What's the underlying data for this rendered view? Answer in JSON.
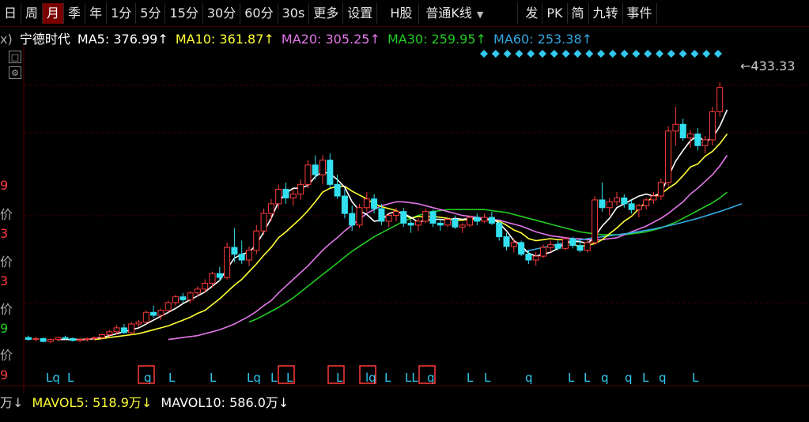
{
  "toolbar": {
    "items": [
      "日",
      "周",
      "月",
      "季",
      "年",
      "1分",
      "5分",
      "15分",
      "30分",
      "60分",
      "30s",
      "更多",
      "设置",
      "H股",
      "普通K线",
      "发",
      "PK",
      "简",
      "九转",
      "事件"
    ],
    "active_index": 2
  },
  "ma_line": {
    "prefix": "ⅹ)",
    "stock": "宁德时代",
    "ma5": "MA5: 376.99↑",
    "ma10": "MA10: 361.87↑",
    "ma20": "MA20: 305.25↑",
    "ma30": "MA30: 259.95↑",
    "ma60": "MA60: 253.38↑"
  },
  "price_label": "433.33",
  "left_labels": [
    "9",
    "价",
    "3",
    "价",
    "3",
    "价",
    "9",
    "价",
    "9"
  ],
  "signals": [
    "Lq",
    "L",
    "q",
    "L",
    "L",
    "Lq",
    "L",
    "L",
    "L",
    "lq",
    "L",
    "LL",
    "q",
    "L",
    "L",
    "q",
    "L",
    "L",
    "q",
    "q",
    "L",
    "q",
    "L"
  ],
  "vol_line": {
    "mavol_prefix": "万↓",
    "mavol5": "MAVOL5: 518.9万↓",
    "mavol10": "MAVOL10: 586.0万↓"
  },
  "colors": {
    "up": "#ff3b3b",
    "down": "#33e0f0",
    "ma5": "#ffffff",
    "ma10": "#ffff33",
    "ma20": "#e277e8",
    "ma30": "#22cc22",
    "ma60": "#33a8e0",
    "active_tab": "#7a0000"
  },
  "chart_data": {
    "type": "candlestick",
    "title": "宁德时代",
    "ylim": [
      145,
      445
    ],
    "candles": [
      [
        162,
        164,
        159,
        160
      ],
      [
        160,
        163,
        158,
        161
      ],
      [
        161,
        162,
        157,
        158
      ],
      [
        158,
        161,
        156,
        160
      ],
      [
        160,
        163,
        158,
        162
      ],
      [
        162,
        164,
        160,
        161
      ],
      [
        161,
        162,
        158,
        159
      ],
      [
        159,
        161,
        157,
        160
      ],
      [
        160,
        162,
        158,
        161
      ],
      [
        161,
        163,
        159,
        162
      ],
      [
        162,
        166,
        160,
        165
      ],
      [
        165,
        170,
        163,
        168
      ],
      [
        168,
        175,
        165,
        172
      ],
      [
        172,
        176,
        166,
        167
      ],
      [
        167,
        178,
        165,
        176
      ],
      [
        176,
        180,
        173,
        178
      ],
      [
        178,
        190,
        176,
        188
      ],
      [
        188,
        195,
        182,
        185
      ],
      [
        185,
        192,
        180,
        190
      ],
      [
        190,
        200,
        188,
        198
      ],
      [
        198,
        206,
        195,
        204
      ],
      [
        204,
        208,
        198,
        201
      ],
      [
        201,
        210,
        198,
        208
      ],
      [
        208,
        215,
        204,
        212
      ],
      [
        212,
        222,
        208,
        218
      ],
      [
        218,
        230,
        214,
        228
      ],
      [
        228,
        235,
        220,
        224
      ],
      [
        224,
        260,
        222,
        255
      ],
      [
        255,
        275,
        240,
        248
      ],
      [
        248,
        262,
        238,
        242
      ],
      [
        242,
        256,
        236,
        252
      ],
      [
        252,
        278,
        248,
        272
      ],
      [
        272,
        295,
        268,
        290
      ],
      [
        290,
        305,
        282,
        300
      ],
      [
        300,
        320,
        295,
        315
      ],
      [
        315,
        322,
        300,
        306
      ],
      [
        306,
        315,
        298,
        310
      ],
      [
        310,
        325,
        304,
        320
      ],
      [
        320,
        345,
        316,
        340
      ],
      [
        340,
        350,
        325,
        330
      ],
      [
        330,
        350,
        320,
        345
      ],
      [
        345,
        352,
        316,
        320
      ],
      [
        320,
        330,
        305,
        308
      ],
      [
        308,
        315,
        285,
        290
      ],
      [
        290,
        298,
        272,
        278
      ],
      [
        278,
        300,
        275,
        296
      ],
      [
        296,
        312,
        292,
        305
      ],
      [
        305,
        310,
        290,
        295
      ],
      [
        295,
        300,
        278,
        282
      ],
      [
        282,
        290,
        276,
        288
      ],
      [
        288,
        296,
        282,
        292
      ],
      [
        292,
        296,
        276,
        280
      ],
      [
        280,
        284,
        270,
        278
      ],
      [
        278,
        285,
        272,
        282
      ],
      [
        282,
        295,
        280,
        292
      ],
      [
        292,
        294,
        276,
        280
      ],
      [
        280,
        284,
        272,
        278
      ],
      [
        278,
        286,
        276,
        284
      ],
      [
        284,
        288,
        274,
        276
      ],
      [
        276,
        280,
        270,
        278
      ],
      [
        278,
        288,
        276,
        286
      ],
      [
        286,
        290,
        278,
        282
      ],
      [
        282,
        290,
        280,
        286
      ],
      [
        286,
        292,
        278,
        280
      ],
      [
        280,
        282,
        262,
        266
      ],
      [
        266,
        270,
        252,
        256
      ],
      [
        256,
        264,
        250,
        260
      ],
      [
        260,
        262,
        246,
        248
      ],
      [
        248,
        252,
        238,
        242
      ],
      [
        242,
        250,
        236,
        246
      ],
      [
        246,
        258,
        244,
        255
      ],
      [
        255,
        262,
        250,
        258
      ],
      [
        258,
        262,
        252,
        254
      ],
      [
        254,
        266,
        252,
        264
      ],
      [
        264,
        266,
        254,
        257
      ],
      [
        257,
        262,
        250,
        252
      ],
      [
        252,
        262,
        250,
        260
      ],
      [
        260,
        308,
        258,
        304
      ],
      [
        304,
        322,
        292,
        296
      ],
      [
        296,
        306,
        288,
        302
      ],
      [
        302,
        312,
        298,
        306
      ],
      [
        306,
        310,
        296,
        300
      ],
      [
        300,
        304,
        290,
        294
      ],
      [
        294,
        300,
        286,
        298
      ],
      [
        298,
        306,
        294,
        304
      ],
      [
        304,
        312,
        300,
        308
      ],
      [
        308,
        326,
        304,
        322
      ],
      [
        322,
        380,
        318,
        375
      ],
      [
        375,
        400,
        360,
        382
      ],
      [
        382,
        388,
        365,
        368
      ],
      [
        368,
        376,
        358,
        372
      ],
      [
        372,
        378,
        355,
        360
      ],
      [
        360,
        370,
        352,
        366
      ],
      [
        366,
        400,
        360,
        395
      ],
      [
        395,
        425,
        390,
        420
      ]
    ],
    "ma5": [
      null,
      null,
      null,
      null,
      160,
      160,
      160,
      160,
      160,
      161,
      162,
      164,
      166,
      168,
      170,
      172,
      176,
      180,
      184,
      188,
      192,
      197,
      201,
      205,
      209,
      215,
      221,
      233,
      244,
      248,
      250,
      258,
      271,
      285,
      302,
      311,
      316,
      316,
      319,
      328,
      333,
      331,
      325,
      317,
      302,
      293,
      289,
      282,
      283,
      290,
      292,
      290,
      286,
      281,
      283,
      284,
      284,
      283,
      285,
      284,
      285,
      285,
      283,
      285,
      280,
      272,
      262,
      257,
      249,
      246,
      248,
      250,
      254,
      260,
      261,
      261,
      259,
      266,
      277,
      285,
      296,
      300,
      304,
      308,
      310,
      308,
      311,
      328,
      344,
      355,
      365,
      370,
      364,
      368,
      380,
      397
    ],
    "ma10": [
      null,
      null,
      null,
      null,
      null,
      null,
      null,
      null,
      null,
      160,
      161,
      162,
      163,
      164,
      165,
      166,
      168,
      170,
      172,
      174,
      177,
      180,
      183,
      187,
      190,
      196,
      202,
      209,
      216,
      222,
      230,
      238,
      247,
      255,
      265,
      271,
      278,
      285,
      293,
      302,
      312,
      316,
      318,
      318,
      313,
      309,
      305,
      300,
      297,
      295,
      293,
      289,
      285,
      287,
      286,
      287,
      286,
      285,
      283,
      283,
      284,
      284,
      284,
      283,
      282,
      278,
      273,
      270,
      264,
      262,
      263,
      264,
      263,
      263,
      258,
      256,
      257,
      259,
      263,
      269,
      275,
      282,
      287,
      295,
      302,
      307,
      310,
      316,
      321,
      329,
      338,
      341,
      349,
      354,
      362,
      372
    ],
    "ma20": [
      null,
      null,
      null,
      null,
      null,
      null,
      null,
      null,
      null,
      null,
      null,
      null,
      null,
      null,
      null,
      null,
      null,
      null,
      null,
      160,
      161,
      162,
      163,
      164,
      166,
      168,
      170,
      173,
      176,
      180,
      184,
      189,
      195,
      200,
      208,
      215,
      222,
      229,
      236,
      244,
      252,
      259,
      265,
      272,
      278,
      284,
      290,
      294,
      298,
      300,
      302,
      302,
      301,
      300,
      298,
      296,
      294,
      292,
      290,
      288,
      287,
      286,
      285,
      284,
      283,
      281,
      279,
      277,
      274,
      271,
      269,
      267,
      266,
      265,
      264,
      264,
      263,
      263,
      263,
      264,
      265,
      268,
      271,
      274,
      277,
      281,
      285,
      290,
      296,
      302,
      310,
      316,
      323,
      330,
      339,
      350
    ],
    "ma30": [
      null,
      null,
      null,
      null,
      null,
      null,
      null,
      null,
      null,
      null,
      null,
      null,
      null,
      null,
      null,
      null,
      null,
      null,
      null,
      null,
      null,
      null,
      null,
      null,
      null,
      null,
      null,
      null,
      null,
      null,
      178,
      181,
      185,
      189,
      193,
      198,
      203,
      209,
      215,
      221,
      227,
      233,
      239,
      245,
      251,
      256,
      261,
      266,
      270,
      274,
      278,
      282,
      285,
      288,
      290,
      292,
      293,
      294,
      294,
      294,
      294,
      294,
      294,
      293,
      292,
      291,
      289,
      287,
      285,
      283,
      281,
      279,
      277,
      275,
      273,
      271,
      270,
      269,
      268,
      268,
      268,
      268,
      269,
      270,
      271,
      273,
      275,
      278,
      281,
      285,
      289,
      293,
      297,
      301,
      306,
      312
    ],
    "ma60": [
      null,
      null,
      null,
      null,
      null,
      null,
      null,
      null,
      null,
      null,
      null,
      null,
      null,
      null,
      null,
      null,
      null,
      null,
      null,
      null,
      null,
      null,
      null,
      null,
      null,
      null,
      null,
      null,
      null,
      null,
      null,
      null,
      null,
      null,
      null,
      null,
      null,
      null,
      null,
      null,
      null,
      null,
      null,
      null,
      null,
      null,
      null,
      null,
      null,
      null,
      null,
      null,
      null,
      null,
      null,
      null,
      null,
      null,
      null,
      null,
      null,
      null,
      null,
      null,
      null,
      null,
      null,
      null,
      null,
      null,
      null,
      null,
      null,
      null,
      null,
      null,
      null,
      null,
      null,
      null,
      null,
      null,
      null,
      null,
      null,
      null,
      null,
      null,
      null,
      null,
      null,
      null,
      null,
      null,
      null,
      null
    ],
    "ma60_tail": [
      [
        67,
        250
      ],
      [
        70,
        255
      ],
      [
        73,
        260
      ],
      [
        76,
        264
      ],
      [
        79,
        267
      ],
      [
        82,
        270
      ],
      [
        85,
        274
      ],
      [
        88,
        279
      ],
      [
        91,
        285
      ],
      [
        94,
        292
      ],
      [
        97,
        300
      ]
    ],
    "diamond_count": 21
  }
}
